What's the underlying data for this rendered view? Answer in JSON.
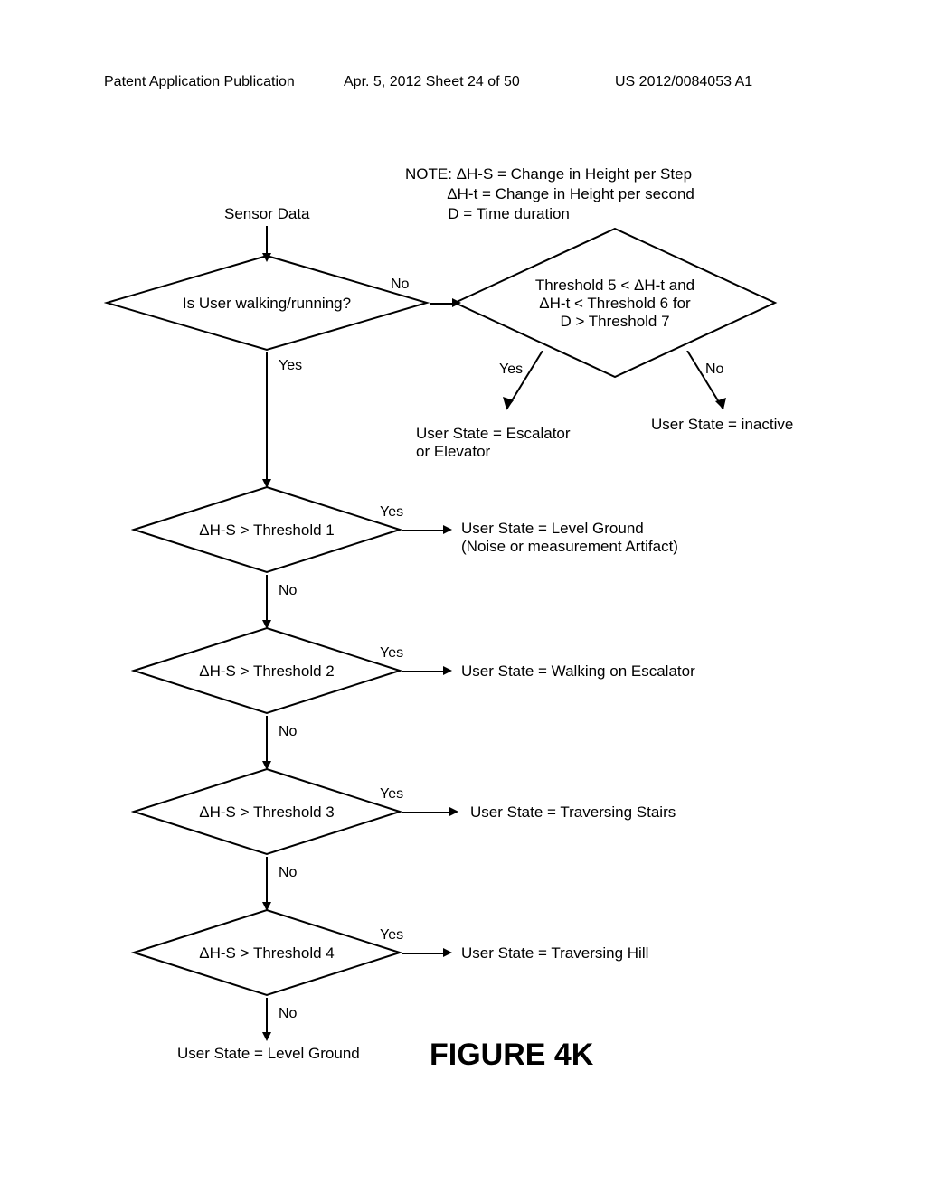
{
  "header": {
    "left": "Patent Application Publication",
    "center": "Apr. 5, 2012  Sheet 24 of 50",
    "right": "US 2012/0084053 A1"
  },
  "note": {
    "line1": "NOTE: ΔH-S = Change in Height per Step",
    "line2": "          ΔH-t = Change in Height per second",
    "line3": "          D = Time duration"
  },
  "labels": {
    "sensor_data": "Sensor Data",
    "figure": "FIGURE 4K"
  },
  "diamonds": {
    "d0": "Is User walking/running?",
    "d0r": "Threshold 5 < ΔH-t and\nΔH-t < Threshold 6 for\nD > Threshold 7",
    "d1": "ΔH-S > Threshold 1",
    "d2": "ΔH-S > Threshold 2",
    "d3": "ΔH-S > Threshold 3",
    "d4": "ΔH-S > Threshold 4"
  },
  "branches": {
    "yes": "Yes",
    "no": "No"
  },
  "outcomes": {
    "escalator_elevator": "User State = Escalator\nor Elevator",
    "inactive": "User State = inactive",
    "level_noise": "User State = Level Ground\n(Noise or measurement Artifact)",
    "escalator_walking": "User State = Walking on Escalator",
    "stairs": "User State = Traversing Stairs",
    "hill": "User State = Traversing Hill",
    "level": "User State = Level Ground"
  },
  "chart_data": {
    "type": "flowchart",
    "start": "Sensor Data",
    "nodes": [
      {
        "id": "D0",
        "type": "decision",
        "text": "Is User walking/running?",
        "yes": "D1",
        "no": "D0R"
      },
      {
        "id": "D0R",
        "type": "decision",
        "text": "Threshold 5 < ΔH-t and ΔH-t < Threshold 6 for D > Threshold 7",
        "yes": "O_ESC_ELEV",
        "no": "O_INACTIVE"
      },
      {
        "id": "D1",
        "type": "decision",
        "text": "ΔH-S > Threshold 1",
        "yes": "O_LEVEL_NOISE",
        "no": "D2"
      },
      {
        "id": "D2",
        "type": "decision",
        "text": "ΔH-S > Threshold 2",
        "yes": "O_ESC_WALK",
        "no": "D3"
      },
      {
        "id": "D3",
        "type": "decision",
        "text": "ΔH-S > Threshold 3",
        "yes": "O_STAIRS",
        "no": "D4"
      },
      {
        "id": "D4",
        "type": "decision",
        "text": "ΔH-S > Threshold 4",
        "yes": "O_HILL",
        "no": "O_LEVEL"
      },
      {
        "id": "O_ESC_ELEV",
        "type": "terminal",
        "text": "User State = Escalator or Elevator"
      },
      {
        "id": "O_INACTIVE",
        "type": "terminal",
        "text": "User State = inactive"
      },
      {
        "id": "O_LEVEL_NOISE",
        "type": "terminal",
        "text": "User State = Level Ground (Noise or measurement Artifact)"
      },
      {
        "id": "O_ESC_WALK",
        "type": "terminal",
        "text": "User State = Walking on Escalator"
      },
      {
        "id": "O_STAIRS",
        "type": "terminal",
        "text": "User State = Traversing Stairs"
      },
      {
        "id": "O_HILL",
        "type": "terminal",
        "text": "User State = Traversing Hill"
      },
      {
        "id": "O_LEVEL",
        "type": "terminal",
        "text": "User State = Level Ground"
      }
    ]
  }
}
